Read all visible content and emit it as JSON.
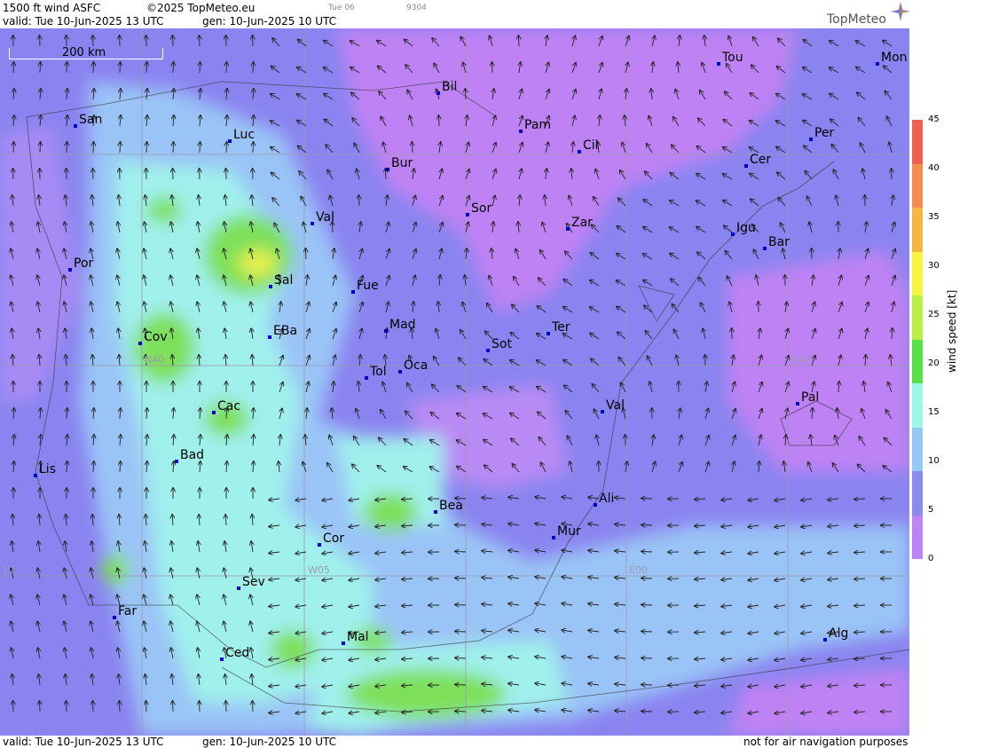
{
  "header": {
    "product": "1500 ft wind ASFC",
    "copyright": "©2025 TopMeteo.eu",
    "small1": "Tue 06",
    "small2": "9304",
    "valid": "valid:  Tue  10-Jun-2025  13 UTC",
    "gen": "gen: 10-Jun-2025 10 UTC",
    "logo": "TopMeteo"
  },
  "footer": {
    "valid": "valid:  Tue  10-Jun-2025  13 UTC",
    "gen": "gen: 10-Jun-2025 10 UTC",
    "disclaimer": "not for air navigation purposes"
  },
  "scale_bar": "200 km",
  "grid_labels": [
    "N40",
    "N40",
    "W05",
    "E00",
    "10"
  ],
  "legend": {
    "unit": "wind speed  [kt]",
    "ticks": [
      "45",
      "40",
      "35",
      "30",
      "25",
      "20",
      "15",
      "10",
      "5",
      "0"
    ],
    "colors": [
      "#f06050",
      "#f58c50",
      "#f4b842",
      "#f5f542",
      "#b9f046",
      "#58e04a",
      "#9ef6e6",
      "#96c8f6",
      "#8a8af0",
      "#bc84f4"
    ]
  },
  "cities": [
    "Tou",
    "Mon",
    "Bil",
    "San",
    "Pam",
    "Luc",
    "Per",
    "Cil",
    "Cer",
    "Bur",
    "Sor",
    "Val",
    "Zar",
    "Igu",
    "Bar",
    "Por",
    "Sal",
    "Fue",
    "Mad",
    "Ter",
    "Cov",
    "EBa",
    "Sot",
    "Tol",
    "Oca",
    "Pal",
    "Cac",
    "Val",
    "Bad",
    "Lis",
    "Bea",
    "Ali",
    "Mur",
    "Cor",
    "Sev",
    "Far",
    "Mal",
    "Alg",
    "Ced"
  ]
}
